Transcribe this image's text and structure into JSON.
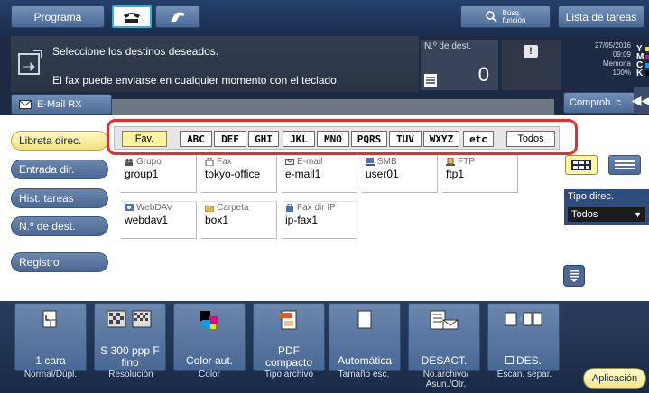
{
  "topbar": {
    "programa": "Programa",
    "search_line1": "Búsq.",
    "search_line2": "función",
    "tasks": "Lista de tareas"
  },
  "message": {
    "line1": "Seleccione los destinos deseados.",
    "line2": "El fax puede enviarse en cualquier momento con el teclado."
  },
  "dest_count": {
    "label": "N.º de dest.",
    "value": "0"
  },
  "status": {
    "date": "27/05/2016",
    "time": "09:09",
    "memory_label": "Memoria",
    "memory_value": "100%",
    "toner_letters": [
      "Y",
      "M",
      "C",
      "K"
    ],
    "toner_colors": [
      "#f2e400",
      "#e4007f",
      "#00a0e9",
      "#000000"
    ]
  },
  "subheader": {
    "email_rx": "E-Mail RX",
    "comprob": "Comprob. c"
  },
  "nav": {
    "items": [
      "Libreta direc.",
      "Entrada dir.",
      "Hist. tareas",
      "N.º de dest.",
      "Registro"
    ]
  },
  "index_tabs": [
    "Fav.",
    "ABC",
    "DEF",
    "GHI",
    "JKL",
    "MNO",
    "PQRS",
    "TUV",
    "WXYZ",
    "etc",
    "Todos"
  ],
  "destinations": [
    {
      "type": "Grupo",
      "name": "group1",
      "icon": "group-icon"
    },
    {
      "type": "Fax",
      "name": "tokyo-office",
      "icon": "fax-icon"
    },
    {
      "type": "E-mail",
      "name": "e-mail1",
      "icon": "email-icon"
    },
    {
      "type": "SMB",
      "name": "user01",
      "icon": "smb-icon"
    },
    {
      "type": "FTP",
      "name": "ftp1",
      "icon": "ftp-icon"
    },
    {
      "type": "WebDAV",
      "name": "webdav1",
      "icon": "webdav-icon"
    },
    {
      "type": "Carpeta",
      "name": "box1",
      "icon": "folder-icon"
    },
    {
      "type": "Fax dir IP",
      "name": "ip-fax1",
      "icon": "ipfax-icon"
    }
  ],
  "tipo_direc": {
    "label": "Tipo direc.",
    "value": "Todos"
  },
  "settings": [
    {
      "value": "1 cara",
      "label": "Normal/Dúpl."
    },
    {
      "value": "S 300 ppp F fino",
      "label": "Resolución"
    },
    {
      "value": "Color aut.",
      "label": "Color"
    },
    {
      "value": "PDF compacto",
      "label": "Tipo archivo"
    },
    {
      "value": "Automática",
      "label": "Tamaño esc."
    },
    {
      "value": "DESACT.",
      "label": "No.archivo/ Asun./Otr."
    },
    {
      "value": "DES.",
      "label": "Escan. separ."
    }
  ],
  "apply": "Aplicación"
}
